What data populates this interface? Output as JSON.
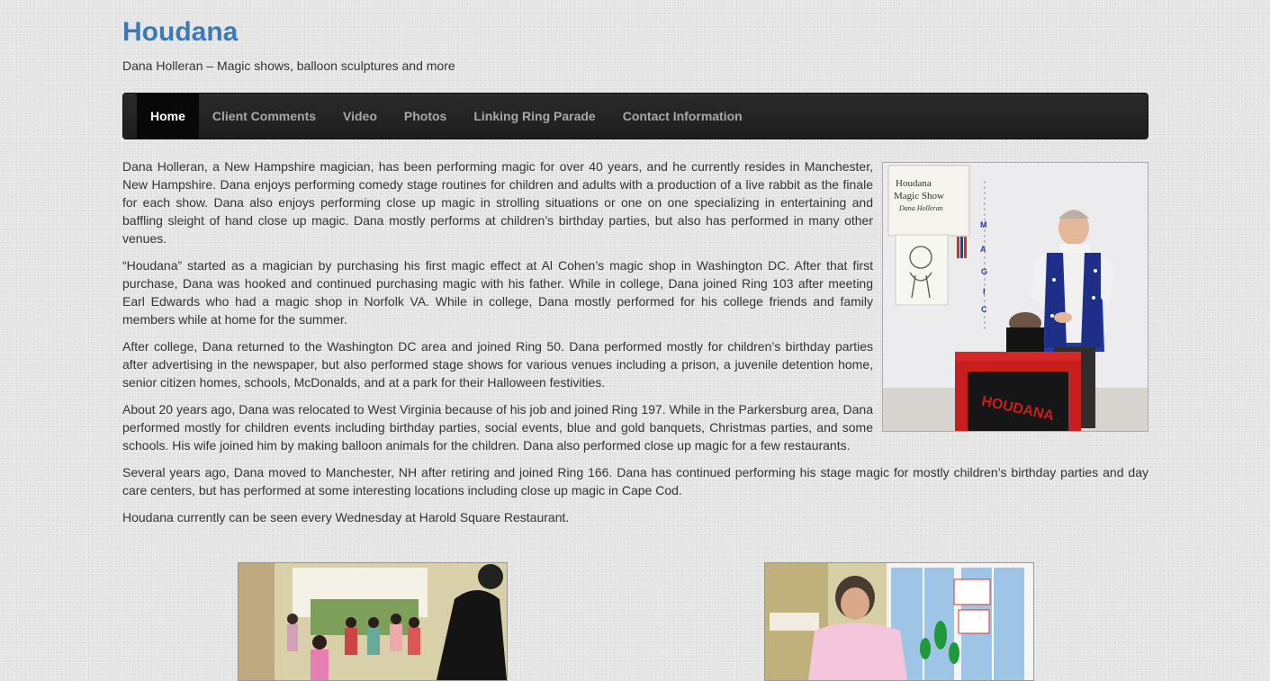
{
  "header": {
    "site_title": "Houdana",
    "tagline": "Dana Holleran – Magic shows, balloon sculptures and more"
  },
  "nav": {
    "items": [
      {
        "label": "Home",
        "active": true
      },
      {
        "label": "Client Comments",
        "active": false
      },
      {
        "label": "Video",
        "active": false
      },
      {
        "label": "Photos",
        "active": false
      },
      {
        "label": "Linking Ring Parade",
        "active": false
      },
      {
        "label": "Contact Information",
        "active": false
      }
    ]
  },
  "main": {
    "featured_image": {
      "sign_line1": "Houdana",
      "sign_line2": "Magic Show",
      "sign_line3": "Dana Holleran",
      "vertical_letters": [
        "M",
        "A",
        "G",
        "I",
        "C"
      ],
      "box_text": "HOUDANA"
    },
    "paragraphs": [
      "Dana Holleran, a New Hampshire magician, has been performing magic for over 40 years, and he currently resides in Manchester, New Hampshire. Dana enjoys performing comedy stage routines for children and adults with a production of a live rabbit as the finale for each show. Dana also enjoys performing close up magic in strolling situations or one on one specializing in entertaining and baffling sleight of hand close up magic. Dana mostly performs at children’s birthday parties, but also has performed in many other venues.",
      "“Houdana” started as a magician by purchasing his first magic effect at Al Cohen’s magic shop in Washington DC. After that first purchase, Dana was hooked and continued purchasing magic with his father. While in college, Dana joined Ring 103 after meeting Earl Edwards who had a magic shop in Norfolk VA. While in college, Dana mostly performed for his college friends and family members while at home for the summer.",
      "After college, Dana returned to the Washington DC area and joined Ring 50. Dana performed mostly for children’s birthday parties after advertising in the newspaper, but also performed stage shows for various venues including a prison, a juvenile detention home, senior citizen homes, schools, McDonalds, and at a park for their Halloween festivities.",
      "About 20 years ago, Dana was relocated to West Virginia because of his job and joined Ring 197. While in the Parkersburg area, Dana performed mostly for children events including birthday parties, social events, blue and gold banquets, Christmas parties, and some schools. His wife joined him by making balloon animals for the children. Dana also performed close up magic for a few restaurants.",
      "Several years ago, Dana moved to Manchester, NH after retiring and joined Ring 166. Dana has continued performing his stage magic for mostly children’s birthday parties and day care centers, but has performed at some interesting locations including close up magic in Cape Cod.",
      "Houdana currently can be seen every Wednesday at Harold Square Restaurant."
    ]
  },
  "colors": {
    "title_blue": "#3a7ab5",
    "navbar_bg": "#222222",
    "nav_active_bg": "#080808",
    "nav_text": "#a8a8a8",
    "box_red": "#c81e1e"
  }
}
